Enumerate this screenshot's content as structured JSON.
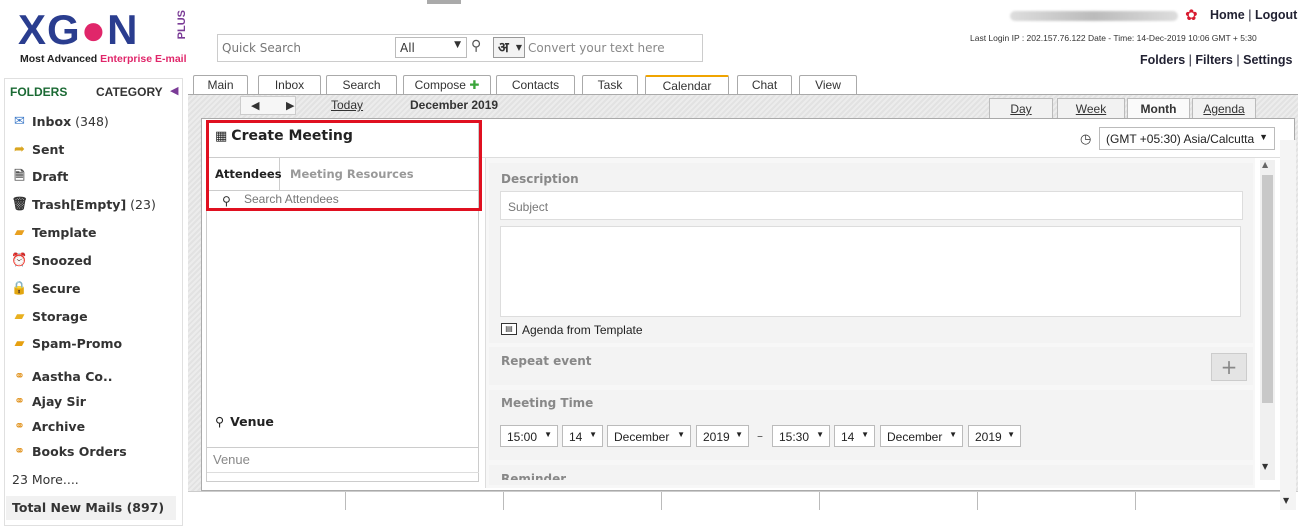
{
  "logo": {
    "brand_pre": "XG",
    "brand_o": "●",
    "brand_post": "N",
    "plus": "PLUS",
    "tagline_pre": "Most Advanced ",
    "tagline_accent": "Enterprise E-mail"
  },
  "top": {
    "quick_search_placeholder": "Quick Search",
    "scope_selected": "All",
    "lang_glyph": "अ",
    "convert_placeholder": "Convert your text here",
    "home": "Home",
    "logout": "Logout",
    "sep": "|",
    "last_login": "Last Login IP : 202.157.76.122 Date - Time: 14-Dec-2019 10:06 GMT + 5:30",
    "folders": "Folders",
    "filters": "Filters",
    "settings": "Settings"
  },
  "sidebar": {
    "folders_label": "FOLDERS",
    "category_label": "CATEGORY",
    "items": [
      {
        "label": "Inbox",
        "count": "(348)",
        "icon": "✉",
        "color": "#3a78c8"
      },
      {
        "label": "Sent",
        "count": "",
        "icon": "➦",
        "color": "#d9a520"
      },
      {
        "label": "Draft",
        "count": "",
        "icon": "🗎",
        "color": "#555555"
      },
      {
        "label": "Trash[Empty]",
        "count": "(23)",
        "icon": "🗑",
        "color": "#333333"
      },
      {
        "label": "Template",
        "count": "",
        "icon": "▰",
        "color": "#e8a020"
      },
      {
        "label": "Snoozed",
        "count": "",
        "icon": "⏰",
        "color": "#333333"
      },
      {
        "label": "Secure",
        "count": "",
        "icon": "🔒",
        "color": "#e3a500"
      },
      {
        "label": "Storage",
        "count": "",
        "icon": "▰",
        "color": "#e8b020"
      },
      {
        "label": "Spam-Promo",
        "count": "",
        "icon": "▰",
        "color": "#e6a010"
      },
      {
        "label": "Aastha Co..",
        "count": "",
        "icon": "⚭",
        "color": "#e09018"
      },
      {
        "label": "Ajay Sir",
        "count": "",
        "icon": "⚭",
        "color": "#e09018"
      },
      {
        "label": "Archive",
        "count": "",
        "icon": "⚭",
        "color": "#e09018"
      },
      {
        "label": "Books Orders",
        "count": "",
        "icon": "⚭",
        "color": "#e09018"
      }
    ],
    "more": "23 More....",
    "total": "Total New Mails (897)"
  },
  "tabs": [
    "Main",
    "Inbox",
    "Search",
    "Compose",
    "Contacts",
    "Task",
    "Calendar",
    "Chat",
    "View"
  ],
  "active_tab": "Calendar",
  "calendar": {
    "today": "Today",
    "month_label": "December 2019",
    "views": [
      "Day",
      "Week",
      "Month",
      "Agenda"
    ],
    "active_view": "Month"
  },
  "meeting": {
    "title": "Create Meeting",
    "tab_attendees": "Attendees",
    "tab_resources": "Meeting Resources",
    "search_placeholder": "Search Attendees",
    "venue_heading": "Venue",
    "venue_placeholder": "Venue",
    "timezone": "(GMT +05:30) Asia/Calcutta",
    "description_label": "Description",
    "subject_placeholder": "Subject",
    "agenda_template": "Agenda from Template",
    "repeat_label": "Repeat event",
    "plus_label": "+",
    "meeting_time_label": "Meeting Time",
    "start": {
      "time": "15:00",
      "day": "14",
      "month": "December",
      "year": "2019"
    },
    "end": {
      "time": "15:30",
      "day": "14",
      "month": "December",
      "year": "2019"
    },
    "range_dash": "–",
    "reminder_label": "Reminder"
  },
  "colors": {
    "accent_tab": "#f0a400",
    "highlight_box": "#e01020",
    "brand_blue": "#2a3d8f",
    "brand_pink": "#e0266a"
  }
}
